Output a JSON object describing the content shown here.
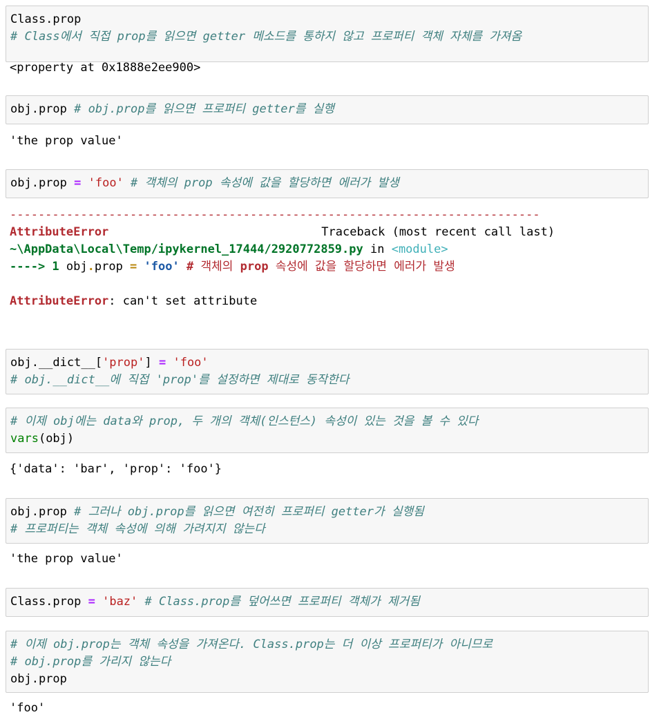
{
  "cells": {
    "c1": {
      "code1": "Class.prop",
      "comment": "# Class에서 직접 prop를 읽으면 getter 메소드를 통하지 않고 프로퍼티 객체 자체를 가져옴",
      "output": "<property at 0x1888e2ee900>"
    },
    "c2": {
      "code": "obj.prop ",
      "comment": "# obj.prop를 읽으면 프로퍼티 getter를 실행",
      "output": "'the prop value'"
    },
    "c3": {
      "code": "obj.prop ",
      "op": "=",
      "str": "'foo'",
      "comment": " # 객체의 prop 속성에 값을 할당하면 에러가 발생"
    },
    "traceback": {
      "dashes": "---------------------------------------------------------------------------",
      "error_name": "AttributeError",
      "traceback_label": "Traceback (most recent call last)",
      "path": "~\\AppData\\Local\\Temp/ipykernel_17444/2920772859.py",
      "in_text": " in ",
      "module": "<module>",
      "arrow": "----> 1 ",
      "code_obj": "obj",
      "code_dot": ".",
      "code_prop": "prop ",
      "code_eq": "=",
      "code_str": "'foo'",
      "code_hash": "#",
      "code_c1": " 객체의 ",
      "code_c2": "prop",
      "code_c3": " 속성에 값을 할당하면 에러가 발생",
      "final_error": "AttributeError",
      "final_msg": ": can't set attribute"
    },
    "c4": {
      "code": "obj.__dict__[",
      "str1": "'prop'",
      "mid": "] ",
      "op": "=",
      "str2": "'foo'",
      "comment": "# obj.__dict__에 직접 'prop'를 설정하면 제대로 동작한다"
    },
    "c5": {
      "comment": "# 이제 obj에는 data와 prop, 두 개의 객체(인스턴스) 속성이 있는 것을 볼 수 있다",
      "builtin": "vars",
      "code": "(obj)",
      "output": "{'data': 'bar', 'prop': 'foo'}"
    },
    "c6": {
      "code": "obj.prop ",
      "comment1": "# 그러나 obj.prop를 읽으면 여전히 프로퍼티 getter가 실행됨",
      "comment2": "# 프로퍼티는 객체 속성에 의해 가려지지 않는다",
      "output": "'the prop value'"
    },
    "c7": {
      "code": "Class.prop ",
      "op": "=",
      "str": "'baz'",
      "comment": " # Class.prop를 덮어쓰면 프로퍼티 객체가 제거됨"
    },
    "c8": {
      "comment1": "# 이제 obj.prop는 객체 속성을 가져온다. Class.prop는 더 이상 프로퍼티가 아니므로",
      "comment2": "# obj.prop를 가리지 않는다",
      "code": "obj.prop",
      "output": "'foo'"
    }
  }
}
